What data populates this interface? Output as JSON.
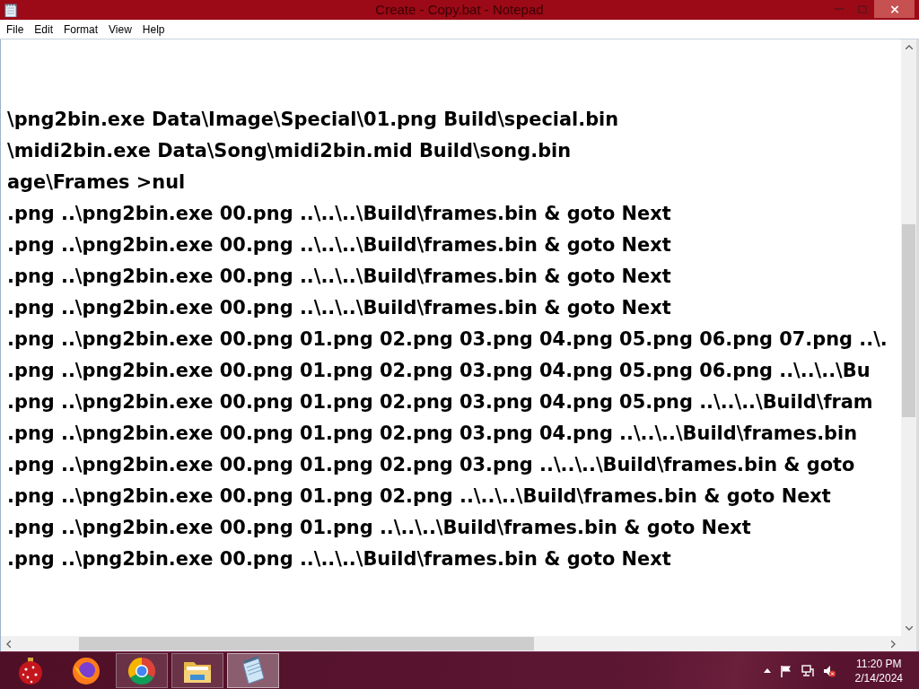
{
  "window": {
    "title": "Create - Copy.bat - Notepad"
  },
  "menu": [
    {
      "label": "File"
    },
    {
      "label": "Edit"
    },
    {
      "label": "Format"
    },
    {
      "label": "View"
    },
    {
      "label": "Help"
    }
  ],
  "editor": {
    "lines": [
      "\\png2bin.exe Data\\Image\\Special\\01.png Build\\special.bin",
      "\\midi2bin.exe Data\\Song\\midi2bin.mid Build\\song.bin",
      "age\\Frames >nul",
      ".png ..\\png2bin.exe 00.png ..\\..\\..\\Build\\frames.bin & goto Next",
      ".png ..\\png2bin.exe 00.png ..\\..\\..\\Build\\frames.bin & goto Next",
      ".png ..\\png2bin.exe 00.png ..\\..\\..\\Build\\frames.bin & goto Next",
      ".png ..\\png2bin.exe 00.png ..\\..\\..\\Build\\frames.bin & goto Next",
      ".png ..\\png2bin.exe 00.png 01.png 02.png 03.png 04.png 05.png 06.png 07.png ..\\.",
      ".png ..\\png2bin.exe 00.png 01.png 02.png 03.png 04.png 05.png 06.png ..\\..\\..\\Bu",
      ".png ..\\png2bin.exe 00.png 01.png 02.png 03.png 04.png 05.png ..\\..\\..\\Build\\fram",
      ".png ..\\png2bin.exe 00.png 01.png 02.png 03.png 04.png ..\\..\\..\\Build\\frames.bin",
      ".png ..\\png2bin.exe 00.png 01.png 02.png 03.png ..\\..\\..\\Build\\frames.bin & goto",
      ".png ..\\png2bin.exe 00.png 01.png 02.png ..\\..\\..\\Build\\frames.bin & goto Next",
      ".png ..\\png2bin.exe 00.png 01.png ..\\..\\..\\Build\\frames.bin & goto Next",
      ".png ..\\png2bin.exe 00.png ..\\..\\..\\Build\\frames.bin & goto Next"
    ]
  },
  "taskbar": {
    "apps": [
      {
        "kind": "ornament",
        "running": false,
        "active": false
      },
      {
        "kind": "fox-browser",
        "running": false,
        "active": false
      },
      {
        "kind": "ring-browser",
        "running": true,
        "active": false
      },
      {
        "kind": "folder",
        "running": true,
        "active": false
      },
      {
        "kind": "notepad",
        "running": true,
        "active": true
      }
    ],
    "tray": {
      "muted": true
    },
    "clock": {
      "time": "11:20 PM",
      "date": "2/14/2024"
    }
  }
}
